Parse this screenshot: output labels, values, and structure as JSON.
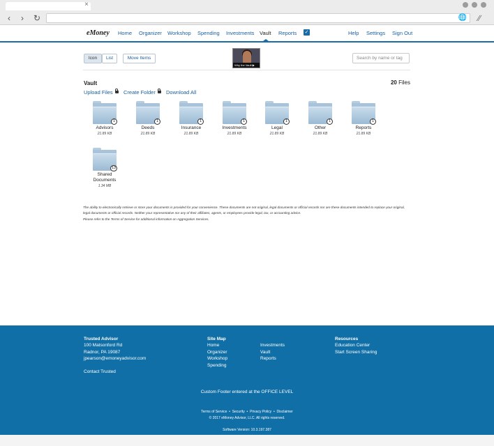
{
  "browser": {
    "tab_close": "×",
    "back_icon": "back-arrow-icon",
    "forward_icon": "forward-arrow-icon",
    "reload_icon": "reload-icon"
  },
  "nav": {
    "logo": "eMoney",
    "items": [
      "Home",
      "Organizer",
      "Workshop",
      "Spending",
      "Investments",
      "Vault",
      "Reports"
    ],
    "active": "Vault",
    "right_items": [
      "Help",
      "Settings",
      "Sign Out"
    ]
  },
  "toolbar": {
    "view_icon": "Icon",
    "view_list": "List",
    "move_items": "Move Items",
    "video_caption": "Why the Vault",
    "search_placeholder": "Search by name or tag"
  },
  "vault": {
    "title": "Vault",
    "files_count": "20",
    "files_label": "Files",
    "actions": [
      "Upload Files",
      "Create Folder",
      "Download All"
    ]
  },
  "folders": [
    {
      "name": "Advisors",
      "size": "21.89 KB",
      "count": "1"
    },
    {
      "name": "Deeds",
      "size": "21.89 KB",
      "count": "1"
    },
    {
      "name": "Insurance",
      "size": "21.89 KB",
      "count": "1"
    },
    {
      "name": "Investments",
      "size": "21.89 KB",
      "count": "1"
    },
    {
      "name": "Legal",
      "size": "21.89 KB",
      "count": "1"
    },
    {
      "name": "Other",
      "size": "21.89 KB",
      "count": "1"
    },
    {
      "name": "Reports",
      "size": "21.89 KB",
      "count": "1"
    },
    {
      "name": "Shared Documents",
      "size": "1.34 MB",
      "count": "13"
    }
  ],
  "disclaimer": {
    "text": "The ability to electronically retrieve or store your documents is provided for your convenience. These documents are not original, legal documents or official records nor are these documents intended to replace your original, legal documents or official records. Neither your representative nor any of their affiliates, agents, or employees provide legal, tax, or accounting advice.",
    "terms": "Please refer to the Terms of Service for additional information on Aggregation Services."
  },
  "footer": {
    "advisor_heading": "Trusted Advisor",
    "address1": "100 Matsonford Rd",
    "address2": "Radnor, PA 19087",
    "email": "jpearson@emoneyadvisor.com",
    "contact": "Contact Trusted",
    "sitemap_heading": "Site Map",
    "sitemap_col1": [
      "Home",
      "Organizer",
      "Workshop",
      "Spending"
    ],
    "sitemap_col2": [
      "Investments",
      "Vault",
      "Reports"
    ],
    "resources_heading": "Resources",
    "resources": [
      "Education Center",
      "Start Screen Sharing"
    ],
    "custom_footer": "Custom Footer entered at the OFFICE LEVEL",
    "legal_links": [
      "Terms of Service",
      "Security",
      "Privacy Policy",
      "Disclaimer"
    ],
    "copyright": "© 2017 eMoney Advisor, LLC. All rights reserved.",
    "version": "Software Version: 10.3.197.387"
  },
  "colors": {
    "accent": "#1a6ca8",
    "footer_bg": "#0f6fa6",
    "link": "#1a5e9e"
  }
}
